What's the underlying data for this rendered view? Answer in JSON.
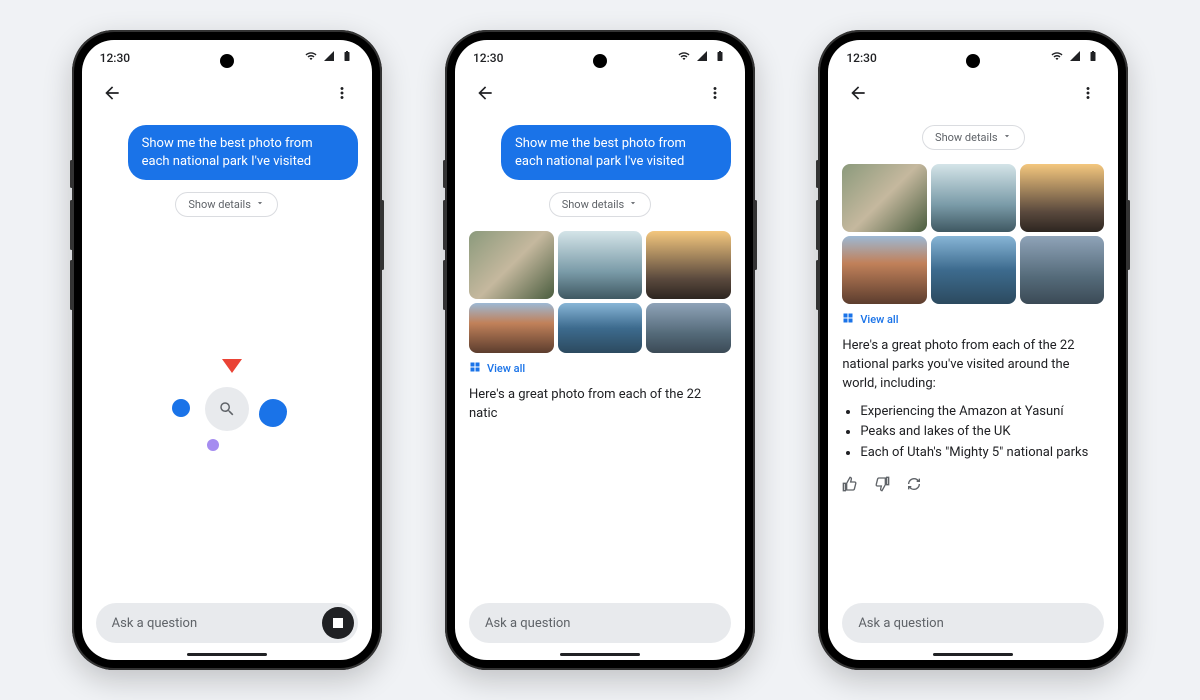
{
  "status": {
    "time": "12:30"
  },
  "chat": {
    "user_message": "Show me the best photo from each national park I've visited",
    "show_details_label": "Show details"
  },
  "view_all_label": "View all",
  "input_placeholder": "Ask a question",
  "screen2": {
    "response_partial": "Here's a great photo from each of the 22 natic"
  },
  "screen3": {
    "response_intro": "Here's a great photo from each of the 22 national parks you've visited around the world, including:",
    "bullets": {
      "0": "Experiencing the Amazon at Yasuní",
      "1": "Peaks and lakes of the UK",
      "2": "Each of Utah's \"Mighty 5\" national parks"
    }
  }
}
